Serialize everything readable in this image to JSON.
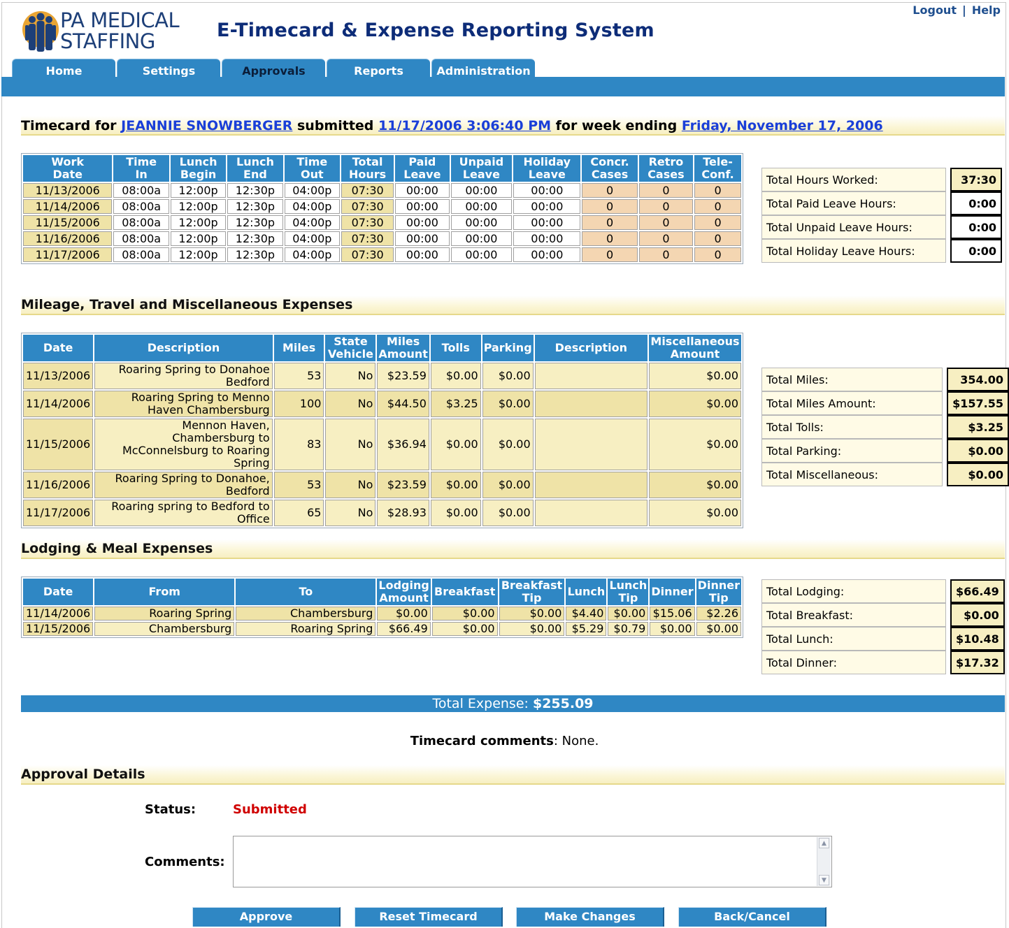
{
  "brand": {
    "line1": "PA MEDICAL",
    "line2": "STAFFING"
  },
  "app_title": "E-Timecard & Expense Reporting System",
  "top_links": {
    "logout": "Logout",
    "separator": "|",
    "help": "Help"
  },
  "tabs": [
    "Home",
    "Settings",
    "Approvals",
    "Reports",
    "Administration"
  ],
  "active_tab": "Approvals",
  "timecard": {
    "prefix": "Timecard for",
    "employee": "JEANNIE SNOWBERGER",
    "submitted_label": "submitted",
    "submitted": "11/17/2006 3:06:40 PM",
    "week_label": "for week ending",
    "week_ending": "Friday, November 17, 2006"
  },
  "hours_table": {
    "headers": [
      [
        "Work",
        "Date"
      ],
      [
        "Time",
        "In"
      ],
      [
        "Lunch",
        "Begin"
      ],
      [
        "Lunch",
        "End"
      ],
      [
        "Time",
        "Out"
      ],
      [
        "Total",
        "Hours"
      ],
      [
        "Paid",
        "Leave"
      ],
      [
        "Unpaid",
        "Leave"
      ],
      [
        "Holiday",
        "Leave"
      ],
      [
        "Concr.",
        "Cases"
      ],
      [
        "Retro",
        "Cases"
      ],
      [
        "Tele-",
        "Conf."
      ]
    ],
    "rows": [
      [
        "11/13/2006",
        "08:00a",
        "12:00p",
        "12:30p",
        "04:00p",
        "07:30",
        "00:00",
        "00:00",
        "00:00",
        "0",
        "0",
        "0"
      ],
      [
        "11/14/2006",
        "08:00a",
        "12:00p",
        "12:30p",
        "04:00p",
        "07:30",
        "00:00",
        "00:00",
        "00:00",
        "0",
        "0",
        "0"
      ],
      [
        "11/15/2006",
        "08:00a",
        "12:00p",
        "12:30p",
        "04:00p",
        "07:30",
        "00:00",
        "00:00",
        "00:00",
        "0",
        "0",
        "0"
      ],
      [
        "11/16/2006",
        "08:00a",
        "12:00p",
        "12:30p",
        "04:00p",
        "07:30",
        "00:00",
        "00:00",
        "00:00",
        "0",
        "0",
        "0"
      ],
      [
        "11/17/2006",
        "08:00a",
        "12:00p",
        "12:30p",
        "04:00p",
        "07:30",
        "00:00",
        "00:00",
        "00:00",
        "0",
        "0",
        "0"
      ]
    ]
  },
  "hours_totals": [
    {
      "label": "Total Hours Worked:",
      "value": "37:30",
      "highlight": true
    },
    {
      "label": "Total Paid Leave Hours:",
      "value": "0:00",
      "highlight": false
    },
    {
      "label": "Total Unpaid Leave Hours:",
      "value": "0:00",
      "highlight": false
    },
    {
      "label": "Total Holiday Leave Hours:",
      "value": "0:00",
      "highlight": false
    }
  ],
  "mileage_section_title": "Mileage, Travel and Miscellaneous Expenses",
  "mileage_table": {
    "headers": [
      [
        "Date"
      ],
      [
        "Description"
      ],
      [
        "Miles"
      ],
      [
        "State",
        "Vehicle"
      ],
      [
        "Miles",
        "Amount"
      ],
      [
        "Tolls"
      ],
      [
        "Parking"
      ],
      [
        "Description"
      ],
      [
        "Miscellaneous",
        "Amount"
      ]
    ],
    "rows": [
      [
        "11/13/2006",
        "Roaring Spring to Donahoe Bedford",
        "53",
        "No",
        "$23.59",
        "$0.00",
        "$0.00",
        "",
        "$0.00"
      ],
      [
        "11/14/2006",
        "Roaring Spring to Menno Haven Chambersburg",
        "100",
        "No",
        "$44.50",
        "$3.25",
        "$0.00",
        "",
        "$0.00"
      ],
      [
        "11/15/2006",
        "Mennon Haven, Chambersburg to McConnelsburg to Roaring Spring",
        "83",
        "No",
        "$36.94",
        "$0.00",
        "$0.00",
        "",
        "$0.00"
      ],
      [
        "11/16/2006",
        "Roaring Spring to Donahoe, Bedford",
        "53",
        "No",
        "$23.59",
        "$0.00",
        "$0.00",
        "",
        "$0.00"
      ],
      [
        "11/17/2006",
        "Roaring spring to Bedford to Office",
        "65",
        "No",
        "$28.93",
        "$0.00",
        "$0.00",
        "",
        "$0.00"
      ]
    ]
  },
  "mileage_totals": [
    {
      "label": "Total Miles:",
      "value": "354.00"
    },
    {
      "label": "Total Miles Amount:",
      "value": "$157.55"
    },
    {
      "label": "Total Tolls:",
      "value": "$3.25"
    },
    {
      "label": "Total Parking:",
      "value": "$0.00"
    },
    {
      "label": "Total Miscellaneous:",
      "value": "$0.00"
    }
  ],
  "lodging_section_title": "Lodging & Meal Expenses",
  "lodging_table": {
    "headers": [
      [
        "Date"
      ],
      [
        "From"
      ],
      [
        "To"
      ],
      [
        "Lodging",
        "Amount"
      ],
      [
        "Breakfast"
      ],
      [
        "Breakfast",
        "Tip"
      ],
      [
        "Lunch"
      ],
      [
        "Lunch",
        "Tip"
      ],
      [
        "Dinner"
      ],
      [
        "Dinner",
        "Tip"
      ]
    ],
    "rows": [
      [
        "11/14/2006",
        "Roaring Spring",
        "Chambersburg",
        "$0.00",
        "$0.00",
        "$0.00",
        "$4.40",
        "$0.00",
        "$15.06",
        "$2.26"
      ],
      [
        "11/15/2006",
        "Chambersburg",
        "Roaring Spring",
        "$66.49",
        "$0.00",
        "$0.00",
        "$5.29",
        "$0.79",
        "$0.00",
        "$0.00"
      ]
    ]
  },
  "lodging_totals": [
    {
      "label": "Total Lodging:",
      "value": "$66.49"
    },
    {
      "label": "Total Breakfast:",
      "value": "$0.00"
    },
    {
      "label": "Total Lunch:",
      "value": "$10.48"
    },
    {
      "label": "Total Dinner:",
      "value": "$17.32"
    }
  ],
  "total_expense": {
    "label": "Total Expense:",
    "value": "$255.09"
  },
  "timecard_comments": {
    "label": "Timecard comments",
    "value": ": None."
  },
  "approval": {
    "title": "Approval Details",
    "status_label": "Status:",
    "status_value": "Submitted",
    "comments_label": "Comments:",
    "comments_value": ""
  },
  "buttons": [
    "Approve",
    "Reset Timecard",
    "Make Changes",
    "Back/Cancel"
  ],
  "colors": {
    "accent": "#2f87c4",
    "row_yellow": "#f7efc2",
    "row_tan": "#f4d6b2",
    "link": "#1a3fd8",
    "status_red": "#d00000"
  }
}
